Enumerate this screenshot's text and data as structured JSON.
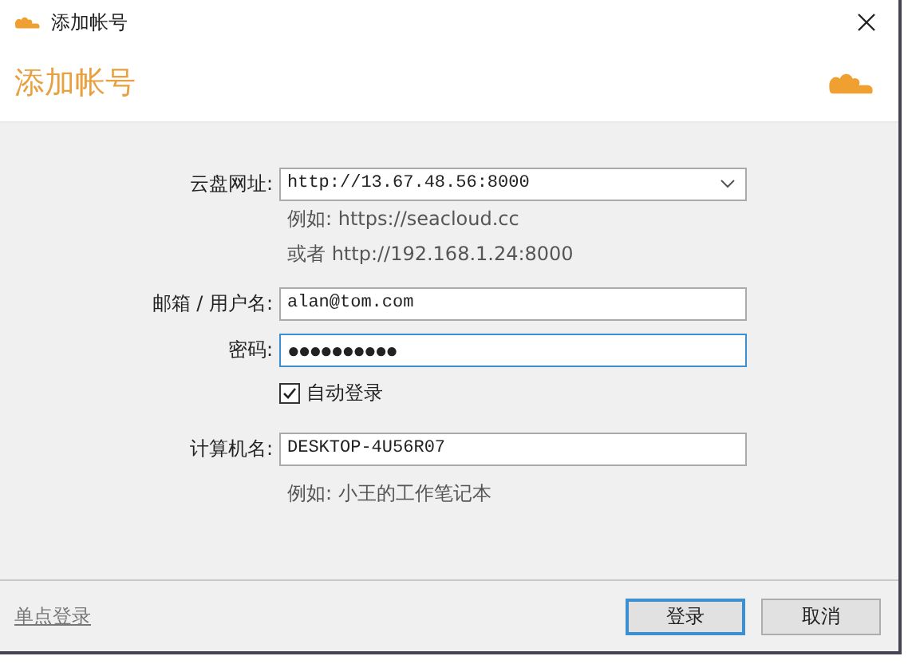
{
  "window": {
    "title": "添加帐号"
  },
  "header": {
    "title": "添加帐号"
  },
  "form": {
    "server": {
      "label": "云盘网址:",
      "value": "http://13.67.48.56:8000",
      "hints": [
        "例如:  https://seacloud.cc",
        "或者 http://192.168.1.24:8000"
      ]
    },
    "email": {
      "label": "邮箱 / 用户名:",
      "value": "alan@tom.com"
    },
    "password": {
      "label": "密码:",
      "value": "●●●●●●●●●●",
      "focused": true
    },
    "auto_login": {
      "label": "自动登录",
      "checked": true
    },
    "computer": {
      "label": "计算机名:",
      "value": "DESKTOP-4U56R07",
      "hint": "例如: 小王的工作笔记本"
    }
  },
  "footer": {
    "link": "单点登录",
    "buttons": [
      {
        "label": "登录",
        "default": true
      },
      {
        "label": "取消",
        "default": false
      }
    ]
  }
}
